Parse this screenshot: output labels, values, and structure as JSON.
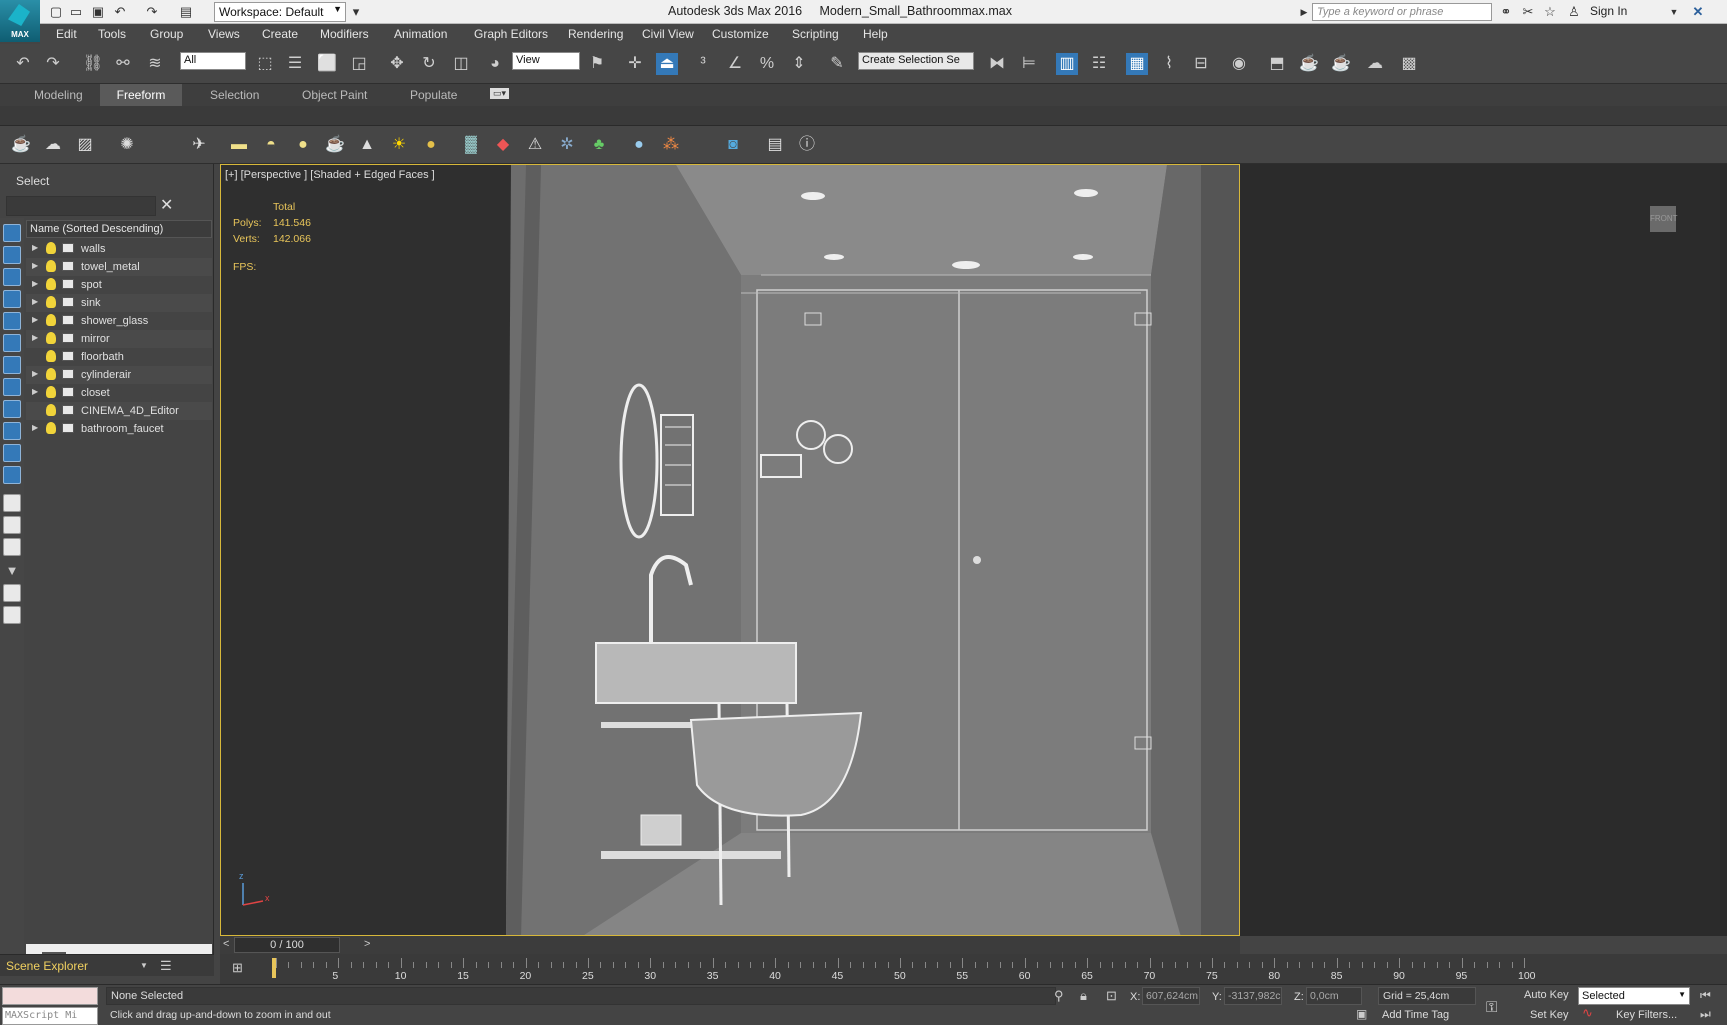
{
  "window": {
    "app_title": "Autodesk 3ds Max 2016",
    "file_title": "Modern_Small_Bathroommax.max",
    "workspace_label": "Workspace: Default",
    "search_placeholder": "Type a keyword or phrase",
    "sign_in": "Sign In",
    "logo_text": "MAX"
  },
  "menu": [
    "Edit",
    "Tools",
    "Group",
    "Views",
    "Create",
    "Modifiers",
    "Animation",
    "Graph Editors",
    "Rendering",
    "Civil View",
    "Customize",
    "Scripting",
    "Help"
  ],
  "main_toolbar": {
    "selection_filter": "All",
    "reference_coord": "View",
    "named_selection": "Create Selection Se"
  },
  "ribbon_tabs": [
    "Modeling",
    "Freeform",
    "Selection",
    "Object Paint",
    "Populate"
  ],
  "ribbon_active_tab": "Freeform",
  "scene_explorer": {
    "title": "Select",
    "column_header": "Name (Sorted Descending)",
    "footer_label": "Scene Explorer",
    "items": [
      {
        "name": "walls",
        "expandable": true
      },
      {
        "name": "towel_metal",
        "expandable": true
      },
      {
        "name": "spot",
        "expandable": true
      },
      {
        "name": "sink",
        "expandable": true
      },
      {
        "name": "shower_glass",
        "expandable": true
      },
      {
        "name": "mirror",
        "expandable": true
      },
      {
        "name": "floorbath",
        "expandable": false
      },
      {
        "name": "cylinderair",
        "expandable": true
      },
      {
        "name": "closet",
        "expandable": true
      },
      {
        "name": "CINEMA_4D_Editor",
        "expandable": false
      },
      {
        "name": "bathroom_faucet",
        "expandable": true
      }
    ]
  },
  "viewport": {
    "label": "[+] [Perspective ] [Shaded + Edged Faces ]",
    "stats_total": "Total",
    "polys_label": "Polys:",
    "polys_value": "141.546",
    "verts_label": "Verts:",
    "verts_value": "142.066",
    "fps_label": "FPS:",
    "viewcube_label": "FRONT"
  },
  "timeline": {
    "slider_text": "0 / 100",
    "ticks": [
      "5",
      "10",
      "15",
      "20",
      "25",
      "30",
      "35",
      "40",
      "45",
      "50",
      "55",
      "60",
      "65",
      "70",
      "75",
      "80",
      "85",
      "90",
      "95",
      "100"
    ]
  },
  "status": {
    "selection": "None Selected",
    "hint": "Click and drag up-and-down to zoom in and out",
    "maxscript": "MAXScript Mi",
    "x_label": "X:",
    "x_value": "607,624cm",
    "y_label": "Y:",
    "y_value": "-3137,982c",
    "z_label": "Z:",
    "z_value": "0,0cm",
    "grid": "Grid = 25,4cm",
    "auto_key": "Auto Key",
    "set_key": "Set Key",
    "key_mode": "Selected",
    "key_filters": "Key Filters...",
    "add_time_tag": "Add Time Tag"
  },
  "colors": {
    "ui_bg": "#464646",
    "viewport_bg": "#2f2f2f",
    "scene_gray": "#777777",
    "stats_yellow": "#e8c55a",
    "active_border": "#d7b83a",
    "accent_blue": "#3479b8"
  }
}
